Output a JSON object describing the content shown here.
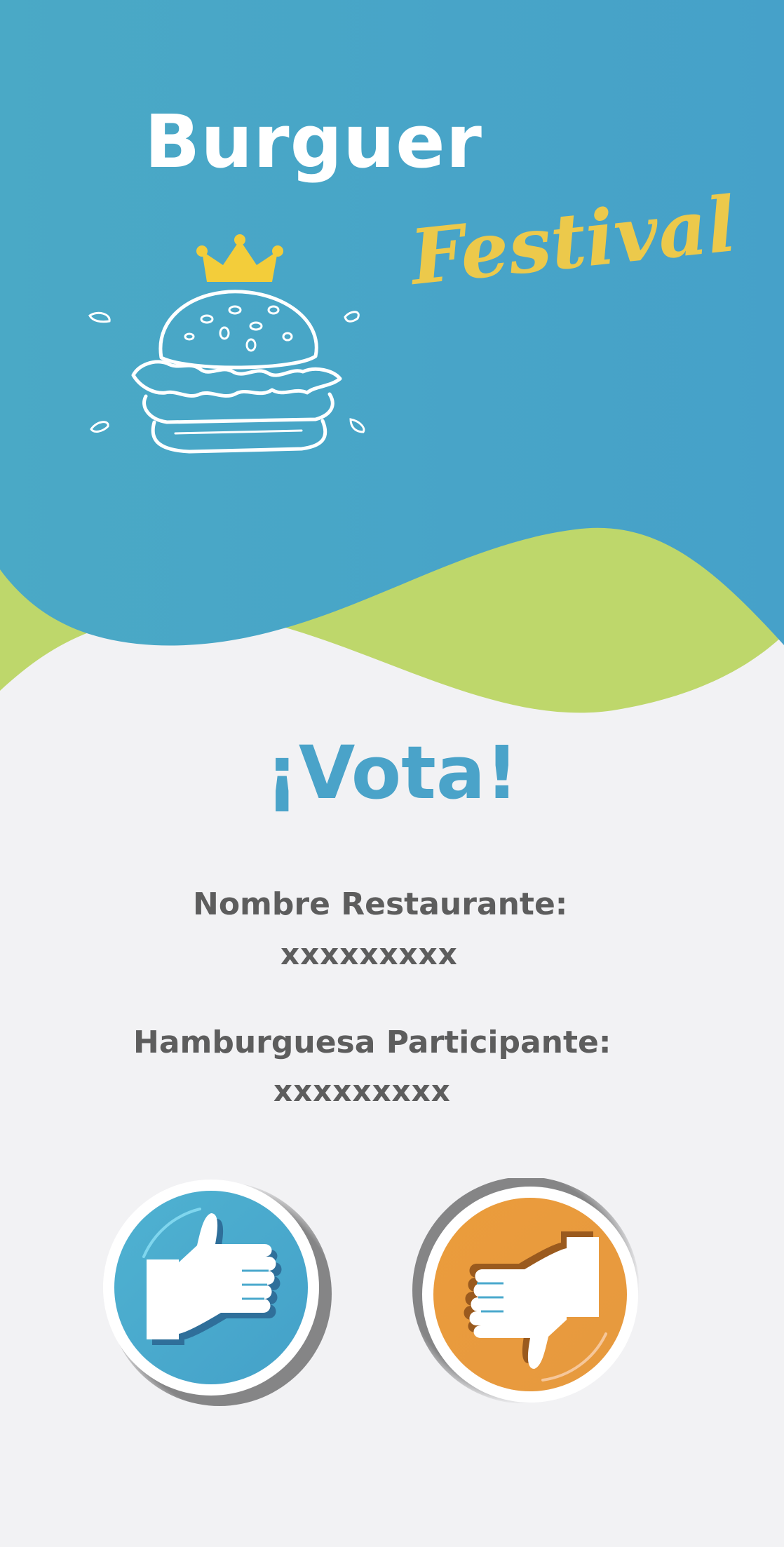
{
  "header": {
    "title": "Burguer",
    "subtitle": "Festival"
  },
  "main": {
    "heading": "¡Vota!",
    "restaurant_label": "Nombre Restaurante:",
    "restaurant_value": "xxxxxxxxx",
    "burger_label": "Hamburguesa Participante:",
    "burger_value": "xxxxxxxxx"
  },
  "vote": {
    "like_icon": "thumbs-up-icon",
    "dislike_icon": "thumbs-down-icon"
  },
  "colors": {
    "header_blue": "#47a2c8",
    "wave_green": "#bed76b",
    "background": "#f2f2f4",
    "accent_yellow": "#ecc94b",
    "text_gray": "#5d5d5d",
    "like_blue": "#4aa8cc",
    "dislike_orange": "#e99a3e"
  }
}
